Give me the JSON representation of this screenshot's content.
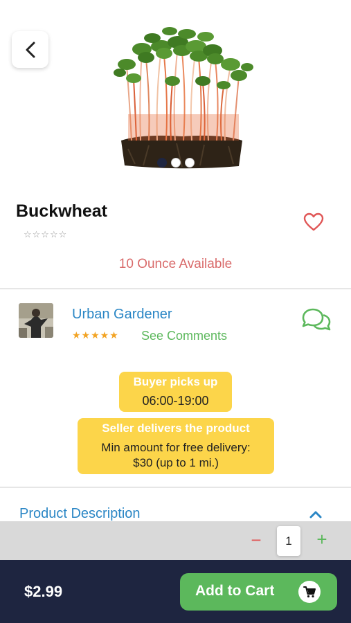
{
  "product": {
    "name": "Buckwheat",
    "rating_stars": "☆☆☆☆☆",
    "availability": "10 Ounce Available",
    "image_slides": 3,
    "active_slide": 0
  },
  "seller": {
    "name": "Urban Gardener",
    "rating_stars": "★★★★★",
    "comments_link": "See Comments"
  },
  "pickup": {
    "heading": "Buyer picks up",
    "hours": "06:00-19:00"
  },
  "delivery": {
    "heading": "Seller delivers the product",
    "line1": "Min amount for free delivery:",
    "line2": "$30 (up to 1 mi.)"
  },
  "description": {
    "title": "Product Description"
  },
  "quantity": {
    "minus": "−",
    "value": "1",
    "plus": "+"
  },
  "footer": {
    "price": "$2.99",
    "add_to_cart": "Add to Cart"
  },
  "icons": {
    "back": "chevron-left-icon",
    "favorite": "heart-outline-icon",
    "chat": "chat-bubbles-icon",
    "collapse": "chevron-up-icon",
    "cart": "cart-icon"
  },
  "colors": {
    "accent_blue": "#2a86c5",
    "accent_green": "#5cb85c",
    "badge_yellow": "#fcd54a",
    "availability_red": "#d96a6a",
    "footer_navy": "#1e2540"
  }
}
